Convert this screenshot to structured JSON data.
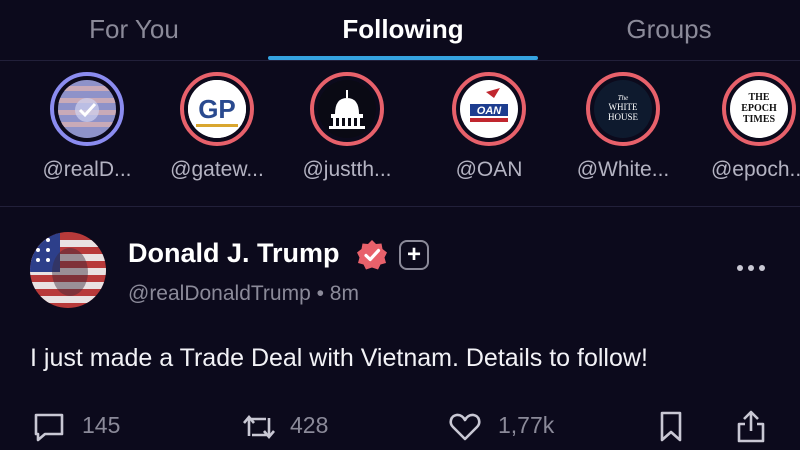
{
  "tabs": [
    {
      "label": "For You"
    },
    {
      "label": "Following"
    },
    {
      "label": "Groups"
    }
  ],
  "active_tab": "Following",
  "stories": [
    {
      "handle": "@realD..."
    },
    {
      "handle": "@gatew...",
      "logo_text": "GP"
    },
    {
      "handle": "@justth..."
    },
    {
      "handle": "@OAN",
      "logo_text": "OAN"
    },
    {
      "handle": "@White...",
      "logo_text": [
        "The",
        "WHITE",
        "HOUSE"
      ]
    },
    {
      "handle": "@epoch...",
      "logo_text": [
        "THE",
        "EPOCH",
        "TIMES"
      ]
    }
  ],
  "post": {
    "author": "Donald J. Trump",
    "meta": "@realDonaldTrump • 8m",
    "plus_label": "+",
    "text": "I just made a Trade Deal with Vietnam. Details to follow!",
    "replies": "145",
    "reposts": "428",
    "likes": "1,77k"
  },
  "icons": {
    "reply": "comment-icon",
    "repost": "repost-icon",
    "like": "heart-icon",
    "bookmark": "bookmark-icon",
    "share": "share-icon",
    "more": "more-icon",
    "verified": "verified-badge-icon"
  },
  "colors": {
    "background": "#0c0a1c",
    "accent": "#35a3e0",
    "story_ring": "#e8616b",
    "verified": "#e8616b",
    "muted_text": "#8b8a99"
  }
}
